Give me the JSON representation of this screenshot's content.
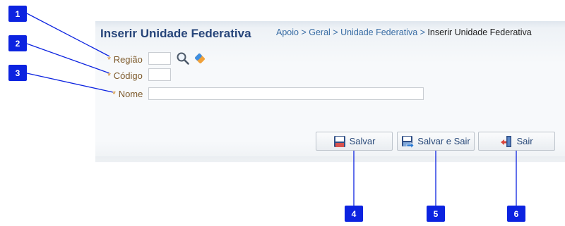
{
  "header": {
    "title": "Inserir Unidade Federativa",
    "breadcrumb": {
      "items": [
        "Apoio",
        "Geral",
        "Unidade Federativa"
      ],
      "separator": " > ",
      "current": "Inserir Unidade Federativa"
    }
  },
  "form": {
    "required_mark": "*",
    "regiao": {
      "label": "Região",
      "value": ""
    },
    "codigo": {
      "label": "Código",
      "value": ""
    },
    "nome": {
      "label": "Nome",
      "value": ""
    }
  },
  "buttons": {
    "salvar": "Salvar",
    "salvar_e_sair": "Salvar e Sair",
    "sair": "Sair"
  },
  "callouts": [
    "1",
    "2",
    "3",
    "4",
    "5",
    "6"
  ],
  "colors": {
    "title": "#27457a",
    "link": "#3a6ea5",
    "label": "#7d5a2b",
    "callout": "#0c23e0"
  }
}
